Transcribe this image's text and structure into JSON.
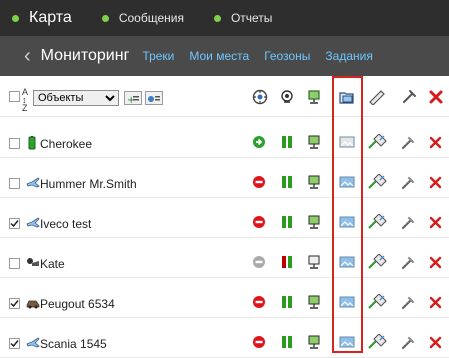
{
  "topnav": {
    "items": [
      {
        "label": "Карта"
      },
      {
        "label": "Сообщения"
      },
      {
        "label": "Отчеты"
      }
    ],
    "dot_color": "#7fd04b"
  },
  "subnav": {
    "back_symbol": "‹",
    "title": "Мониторинг",
    "links": [
      "Треки",
      "Мои места",
      "Геозоны",
      "Задания"
    ],
    "link_color": "#6fc6ff"
  },
  "toolbar": {
    "sort_label": "A↕Z",
    "objects_select": "Объекты"
  },
  "units": [
    {
      "name": "Cherokee",
      "checked": false,
      "icon": "battery-icon",
      "status": "ok"
    },
    {
      "name": "Hummer Mr.Smith",
      "checked": false,
      "icon": "plane-icon",
      "status": "stop"
    },
    {
      "name": "Iveco test",
      "checked": true,
      "icon": "plane-icon",
      "status": "stop"
    },
    {
      "name": "Kate",
      "checked": false,
      "icon": "person-icon",
      "status": "offline"
    },
    {
      "name": "Peugout 6534",
      "checked": true,
      "icon": "car-icon",
      "status": "stop"
    },
    {
      "name": "Scania 1545",
      "checked": true,
      "icon": "plane-icon",
      "status": "stop"
    }
  ],
  "highlight_color": "#d9231e"
}
